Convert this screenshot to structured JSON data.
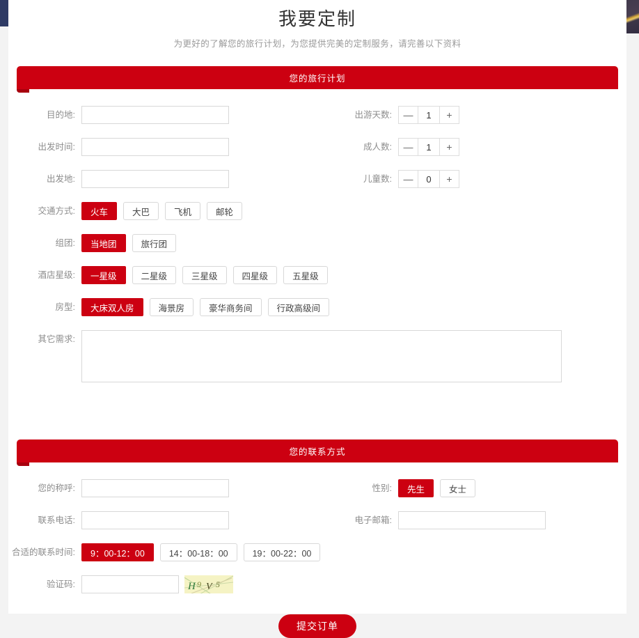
{
  "header": {
    "title": "我要定制",
    "subtitle": "为更好的了解您的旅行计划，为您提供完美的定制服务，请完善以下资料"
  },
  "colors": {
    "brand_red": "#cc0011",
    "banner_shadow": "#a8000e",
    "label_gray": "#8d8d8d",
    "border_gray": "#d8d8d8",
    "page_bg": "#f3f3f3",
    "left_strip_navy": "#2e3a64",
    "captcha_bg": "#f5f3c4"
  },
  "plan_section": {
    "banner_title": "您的旅行计划",
    "fields": {
      "destination": {
        "label": "目的地:",
        "value": "",
        "placeholder": ""
      },
      "depart_time": {
        "label": "出发时间:",
        "value": "",
        "placeholder": ""
      },
      "depart_place": {
        "label": "出发地:",
        "value": "",
        "placeholder": ""
      },
      "other_needs": {
        "label": "其它需求:",
        "value": "",
        "placeholder": ""
      }
    },
    "steppers": [
      {
        "label": "出游天数:",
        "value": "1",
        "minus": "—",
        "plus": "+"
      },
      {
        "label": "成人数:",
        "value": "1",
        "minus": "—",
        "plus": "+"
      },
      {
        "label": "儿童数:",
        "value": "0",
        "minus": "—",
        "plus": "+"
      }
    ],
    "transport": {
      "label": "交通方式:",
      "options": [
        "火车",
        "大巴",
        "飞机",
        "邮轮"
      ],
      "selected": "火车"
    },
    "group": {
      "label": "组团:",
      "options": [
        "当地团",
        "旅行团"
      ],
      "selected": "当地团"
    },
    "hotel_star": {
      "label": "酒店星级:",
      "options": [
        "一星级",
        "二星级",
        "三星级",
        "四星级",
        "五星级"
      ],
      "selected": "一星级"
    },
    "room_type": {
      "label": "房型:",
      "options": [
        "大床双人房",
        "海景房",
        "豪华商务间",
        "行政高级间"
      ],
      "selected": "大床双人房"
    }
  },
  "contact_section": {
    "banner_title": "您的联系方式",
    "fields": {
      "name": {
        "label": "您的称呼:",
        "value": "",
        "placeholder": ""
      },
      "phone": {
        "label": "联系电话:",
        "value": "",
        "placeholder": ""
      },
      "email": {
        "label": "电子邮箱:",
        "value": "",
        "placeholder": ""
      },
      "captcha": {
        "label": "验证码:",
        "value": "",
        "placeholder": "",
        "image_text": "H9V5"
      }
    },
    "gender": {
      "label": "性别:",
      "options": [
        "先生",
        "女士"
      ],
      "selected": "先生"
    },
    "contact_time": {
      "label": "合适的联系时间:",
      "options": [
        "9：00-12：00",
        "14：00-18：00",
        "19：00-22：00"
      ],
      "selected": "9：00-12：00"
    }
  },
  "submit": {
    "label": "提交订单"
  }
}
